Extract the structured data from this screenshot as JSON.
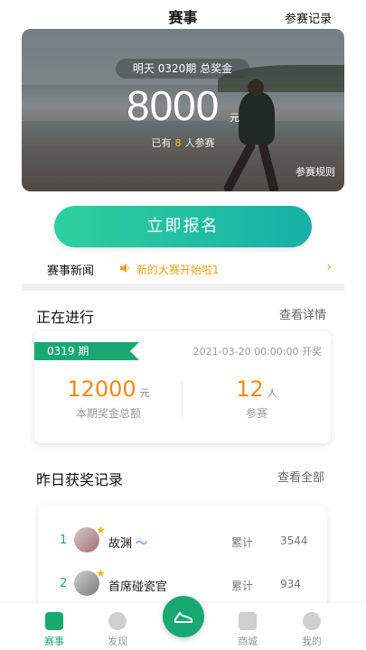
{
  "header": {
    "title": "赛事",
    "records_link": "参赛记录"
  },
  "hero": {
    "pill_text": "明天 0320期 总奖金",
    "amount": "8000",
    "unit": "元",
    "joined_prefix": "已有",
    "joined_count": "8",
    "joined_suffix": "人参赛",
    "rules_link": "参赛规则"
  },
  "signup_button": "立即报名",
  "news": {
    "label": "赛事新闻",
    "text": "新的大赛开始啦1",
    "arrow": "›"
  },
  "ongoing": {
    "title": "正在进行",
    "more": "查看详情",
    "period": "0319 期",
    "time": "2021-03-20 00:00:00 开奖",
    "prize_amount": "12000",
    "prize_unit": "元",
    "prize_caption": "本期奖金总额",
    "participants": "12",
    "participants_unit": "人",
    "participants_caption": "参赛"
  },
  "winners": {
    "title": "昨日获奖记录",
    "more": "查看全部",
    "rows": [
      {
        "rank": "1",
        "name": "故渊",
        "label": "累计",
        "value": "3544"
      },
      {
        "rank": "2",
        "name": "首席碰瓷官",
        "label": "累计",
        "value": "934"
      }
    ]
  },
  "tabs": [
    {
      "label": "赛事",
      "icon": "trophy-icon"
    },
    {
      "label": "发现",
      "icon": "discover-icon"
    },
    {
      "label": "",
      "icon": "shoe-icon"
    },
    {
      "label": "商城",
      "icon": "shop-icon"
    },
    {
      "label": "我的",
      "icon": "profile-icon"
    }
  ],
  "colors": {
    "accent": "#1aa872",
    "orange": "#f08a12",
    "news": "#e9a31a"
  }
}
